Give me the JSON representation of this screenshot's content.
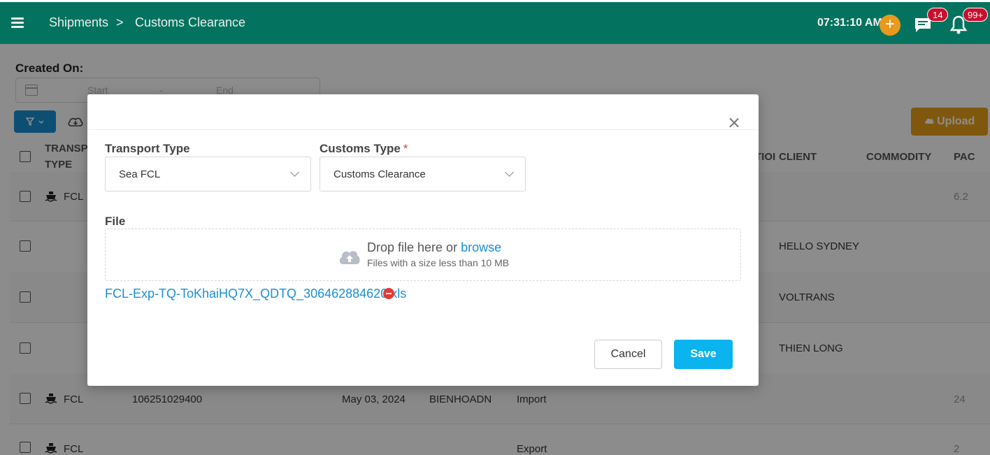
{
  "header": {
    "breadcrumb": [
      "Shipments",
      ">",
      "Customs Clearance"
    ],
    "clock": "07:31:10 AM",
    "add_icon": "plus-circle-icon",
    "chat_badge": "14",
    "notification_badge": "99+",
    "bg_color": "#03735f"
  },
  "filters": {
    "created_on_label": "Created On:",
    "start_placeholder": "Start",
    "range_separator": "-",
    "end_placeholder": "End",
    "upload_label": "Upload"
  },
  "table": {
    "headers": {
      "transport_type_line1": "TRANSPO",
      "transport_type_line2": "TYPE",
      "location_partial": "TIOI",
      "client": "CLIENT",
      "commodity": "COMMODITY",
      "package_partial": "PAC"
    },
    "rows": [
      {
        "type": "FCL",
        "col2": "",
        "date": "",
        "location": "",
        "direction": "",
        "client": "",
        "package": "6.2"
      },
      {
        "type": "",
        "col2": "",
        "date": "",
        "location": "",
        "direction": "",
        "client": "HELLO SYDNEY",
        "package": ""
      },
      {
        "type": "",
        "col2": "",
        "date": "",
        "location": "",
        "direction": "",
        "client": "VOLTRANS",
        "package": ""
      },
      {
        "type": "",
        "col2": "",
        "date": "",
        "location": "",
        "direction": "",
        "client": "THIEN LONG",
        "package": ""
      },
      {
        "type": "FCL",
        "col2": "106251029400",
        "date": "May 03, 2024",
        "location": "BIENHOADN",
        "direction": "Import",
        "client": "",
        "package": "24"
      },
      {
        "type": "FCL",
        "col2": "",
        "date": "",
        "location": "",
        "direction": "Export",
        "client": "",
        "package": "2"
      }
    ]
  },
  "modal": {
    "transport_type_label": "Transport Type",
    "transport_type_value": "Sea FCL",
    "customs_type_label": "Customs Type",
    "required_mark": "*",
    "customs_type_value": "Customs Clearance",
    "file_label": "File",
    "drop_text": "Drop file here or",
    "browse_text": "browse",
    "drop_hint": "Files with a size less than 10 MB",
    "file_name": "FCL-Exp-TQ-ToKhaiHQ7X_QDTQ_306462884620.xls",
    "cancel_label": "Cancel",
    "save_label": "Save"
  }
}
